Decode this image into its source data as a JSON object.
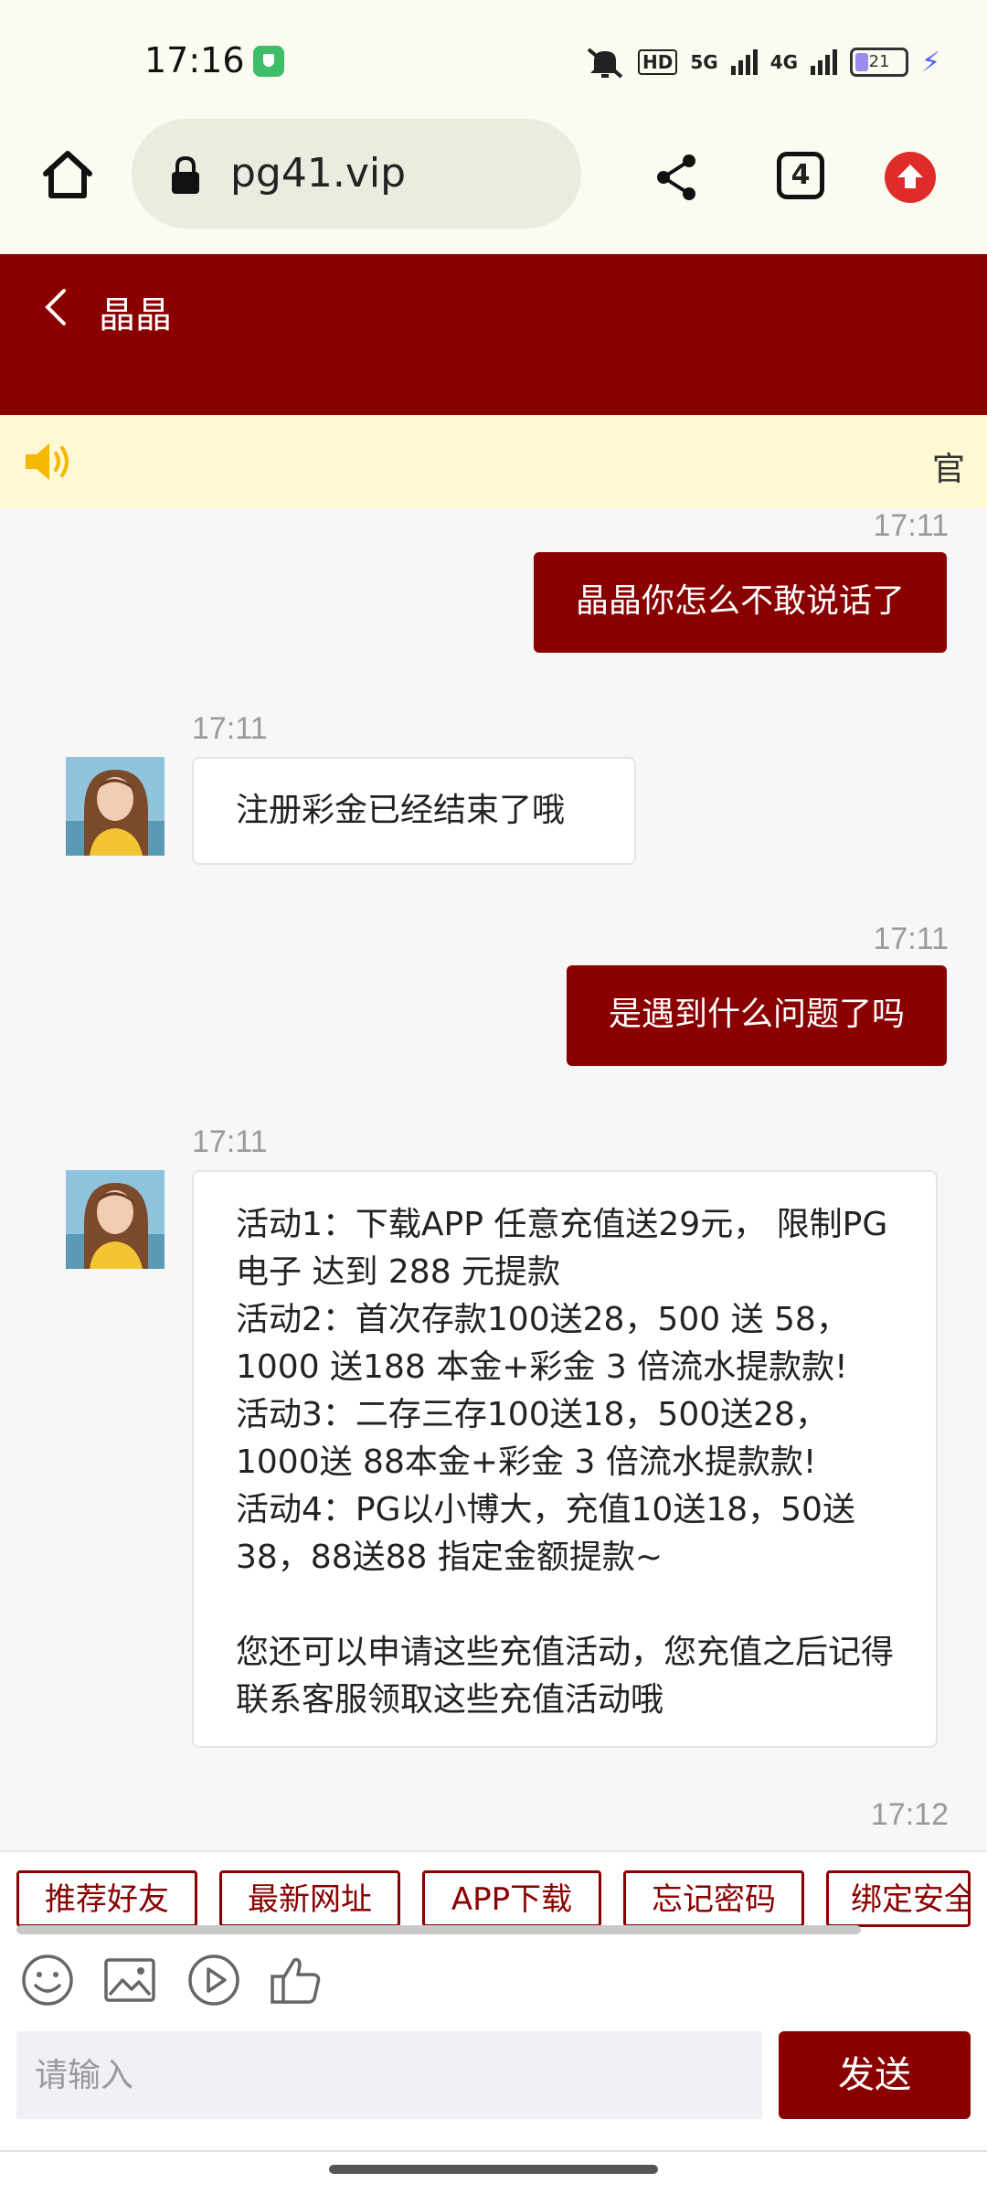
{
  "status_bar": {
    "time": "17:16",
    "net_hd": "HD",
    "net_5g": "5G",
    "net_4g": "4G",
    "battery": "21"
  },
  "browser": {
    "url": "pg41.vip",
    "tab_count": "4"
  },
  "chat": {
    "title": "晶晶",
    "notice": "官"
  },
  "messages": [
    {
      "time": "17:11",
      "direction": "out",
      "text": "晶晶你怎么不敢说话了"
    },
    {
      "time": "17:11",
      "direction": "in",
      "text": "注册彩金已经结束了哦"
    },
    {
      "time": "17:11",
      "direction": "out",
      "text": "是遇到什么问题了吗"
    },
    {
      "time": "17:11",
      "direction": "in",
      "text": "活动1：下载APP 任意充值送29元， 限制PG电子 达到 288 元提款\n活动2：首次存款100送28，500 送 58，1000 送188 本金+彩金 3 倍流水提款款!\n活动3：二存三存100送18，500送28，1000送 88本金+彩金 3 倍流水提款款!\n活动4：PG以小博大，充值10送18，50送38，88送88 指定金额提款~\n\n您还可以申请这些充值活动，您充值之后记得联系客服领取这些充值活动哦"
    },
    {
      "time": "17:12"
    }
  ],
  "quick_buttons": [
    "推荐好友",
    "最新网址",
    "APP下载",
    "忘记密码",
    "绑定安全"
  ],
  "input": {
    "placeholder": "请输入",
    "send_label": "发送"
  },
  "colors": {
    "brand": "#8a0000",
    "notice_bg": "#fff8d2",
    "chrome_bg": "#fcfbf1"
  }
}
